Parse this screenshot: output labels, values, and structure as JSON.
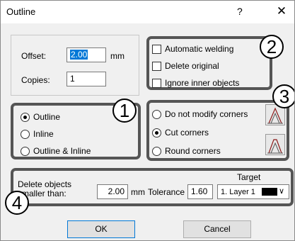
{
  "window": {
    "title": "Outline",
    "help_label": "?",
    "close_label": "✕"
  },
  "offset": {
    "label": "Offset:",
    "value": "2.00",
    "unit": "mm"
  },
  "copies": {
    "label": "Copies:",
    "value": "1"
  },
  "options": {
    "automatic_welding": "Automatic welding",
    "delete_original": "Delete original",
    "ignore_inner_objects": "Ignore inner objects"
  },
  "direction": {
    "options": [
      "Outline",
      "Inline",
      "Outline & Inline"
    ],
    "selected": "Outline"
  },
  "corners": {
    "options": [
      "Do not modify corners",
      "Cut corners",
      "Round corners"
    ],
    "selected": "Cut corners"
  },
  "bottom": {
    "delete_label_line1": "Delete objects",
    "delete_label_line2": "smaller than:",
    "delete_value": "2.00",
    "delete_unit": "mm",
    "tolerance_label": "Tolerance",
    "tolerance_value": "1.60",
    "target_label": "Target",
    "target_value": "1. Layer 1",
    "target_color": "#000000"
  },
  "badges": [
    "1",
    "2",
    "3",
    "4"
  ],
  "buttons": {
    "ok": "OK",
    "cancel": "Cancel"
  },
  "colors": {
    "highlight_border": "#555555",
    "selection": "#0078d7",
    "dialog_bg": "#f0f0f0"
  }
}
